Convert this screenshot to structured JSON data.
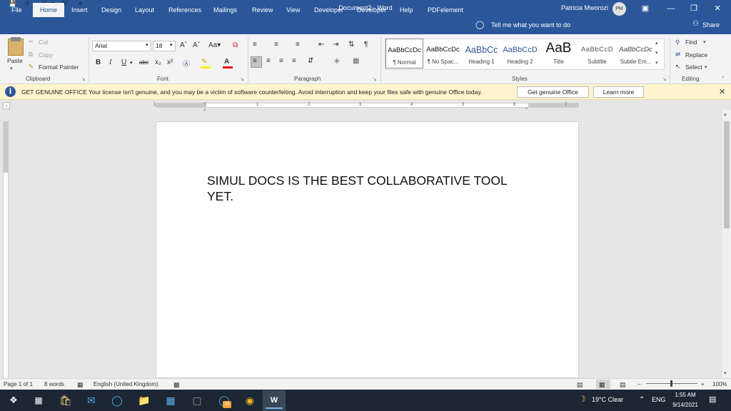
{
  "titlebar": {
    "doc_title": "Document2  -  Word",
    "user_name": "Patricia Mworozi",
    "avatar_initials": "PM",
    "autosave_hint": "A⁾"
  },
  "tabs": [
    "File",
    "Home",
    "Insert",
    "Design",
    "Layout",
    "References",
    "Mailings",
    "Review",
    "View",
    "Developer",
    "Developer",
    "Help",
    "PDFelement"
  ],
  "tell_me": "Tell me what you want to do",
  "share": "Share",
  "clipboard": {
    "paste": "Paste",
    "cut": "Cut",
    "copy": "Copy",
    "format_painter": "Format Painter",
    "label": "Clipboard"
  },
  "font": {
    "family": "Arial",
    "size": "18",
    "label": "Font",
    "buttons": [
      "B",
      "I",
      "U",
      "abc",
      "x₂",
      "x²"
    ]
  },
  "paragraph": {
    "label": "Paragraph"
  },
  "styles": {
    "label": "Styles",
    "items": [
      {
        "sample": "AaBbCcDc",
        "name": "¶ Normal"
      },
      {
        "sample": "AaBbCcDc",
        "name": "¶ No Spac..."
      },
      {
        "sample": "AaBbCc",
        "name": "Heading 1"
      },
      {
        "sample": "AaBbCcD",
        "name": "Heading 2"
      },
      {
        "sample": "AaB",
        "name": "Title"
      },
      {
        "sample": "AaBbCcD",
        "name": "Subtitle"
      },
      {
        "sample": "AaBbCcDc",
        "name": "Subtle Em..."
      }
    ]
  },
  "editing": {
    "find": "Find",
    "replace": "Replace",
    "select": "Select",
    "label": "Editing"
  },
  "message_bar": {
    "title": "GET GENUINE OFFICE",
    "text": "Your license isn't genuine, and you may be a victim of software counterfeiting. Avoid interruption and keep your files safe with genuine Office today.",
    "button1": "Get genuine Office",
    "button2": "Learn more"
  },
  "ruler_numbers": [
    "1",
    "1",
    "2",
    "3",
    "4",
    "5",
    "6",
    "7"
  ],
  "document": {
    "text": "SIMUL DOCS IS THE BEST COLLABORATIVE TOOL YET."
  },
  "status": {
    "page": "Page 1 of 1",
    "words": "8 words",
    "language": "English (United Kingdom)",
    "zoom": "100%",
    "zoom_level": 1.0
  },
  "taskbar": {
    "weather": "19°C  Clear",
    "lang": "ENG",
    "time": "1:55 AM",
    "date": "9/14/2021",
    "badge": "20"
  },
  "colors": {
    "word_blue": "#2b579a",
    "message_bar": "#fff4ce",
    "taskbar": "#1c2733"
  }
}
